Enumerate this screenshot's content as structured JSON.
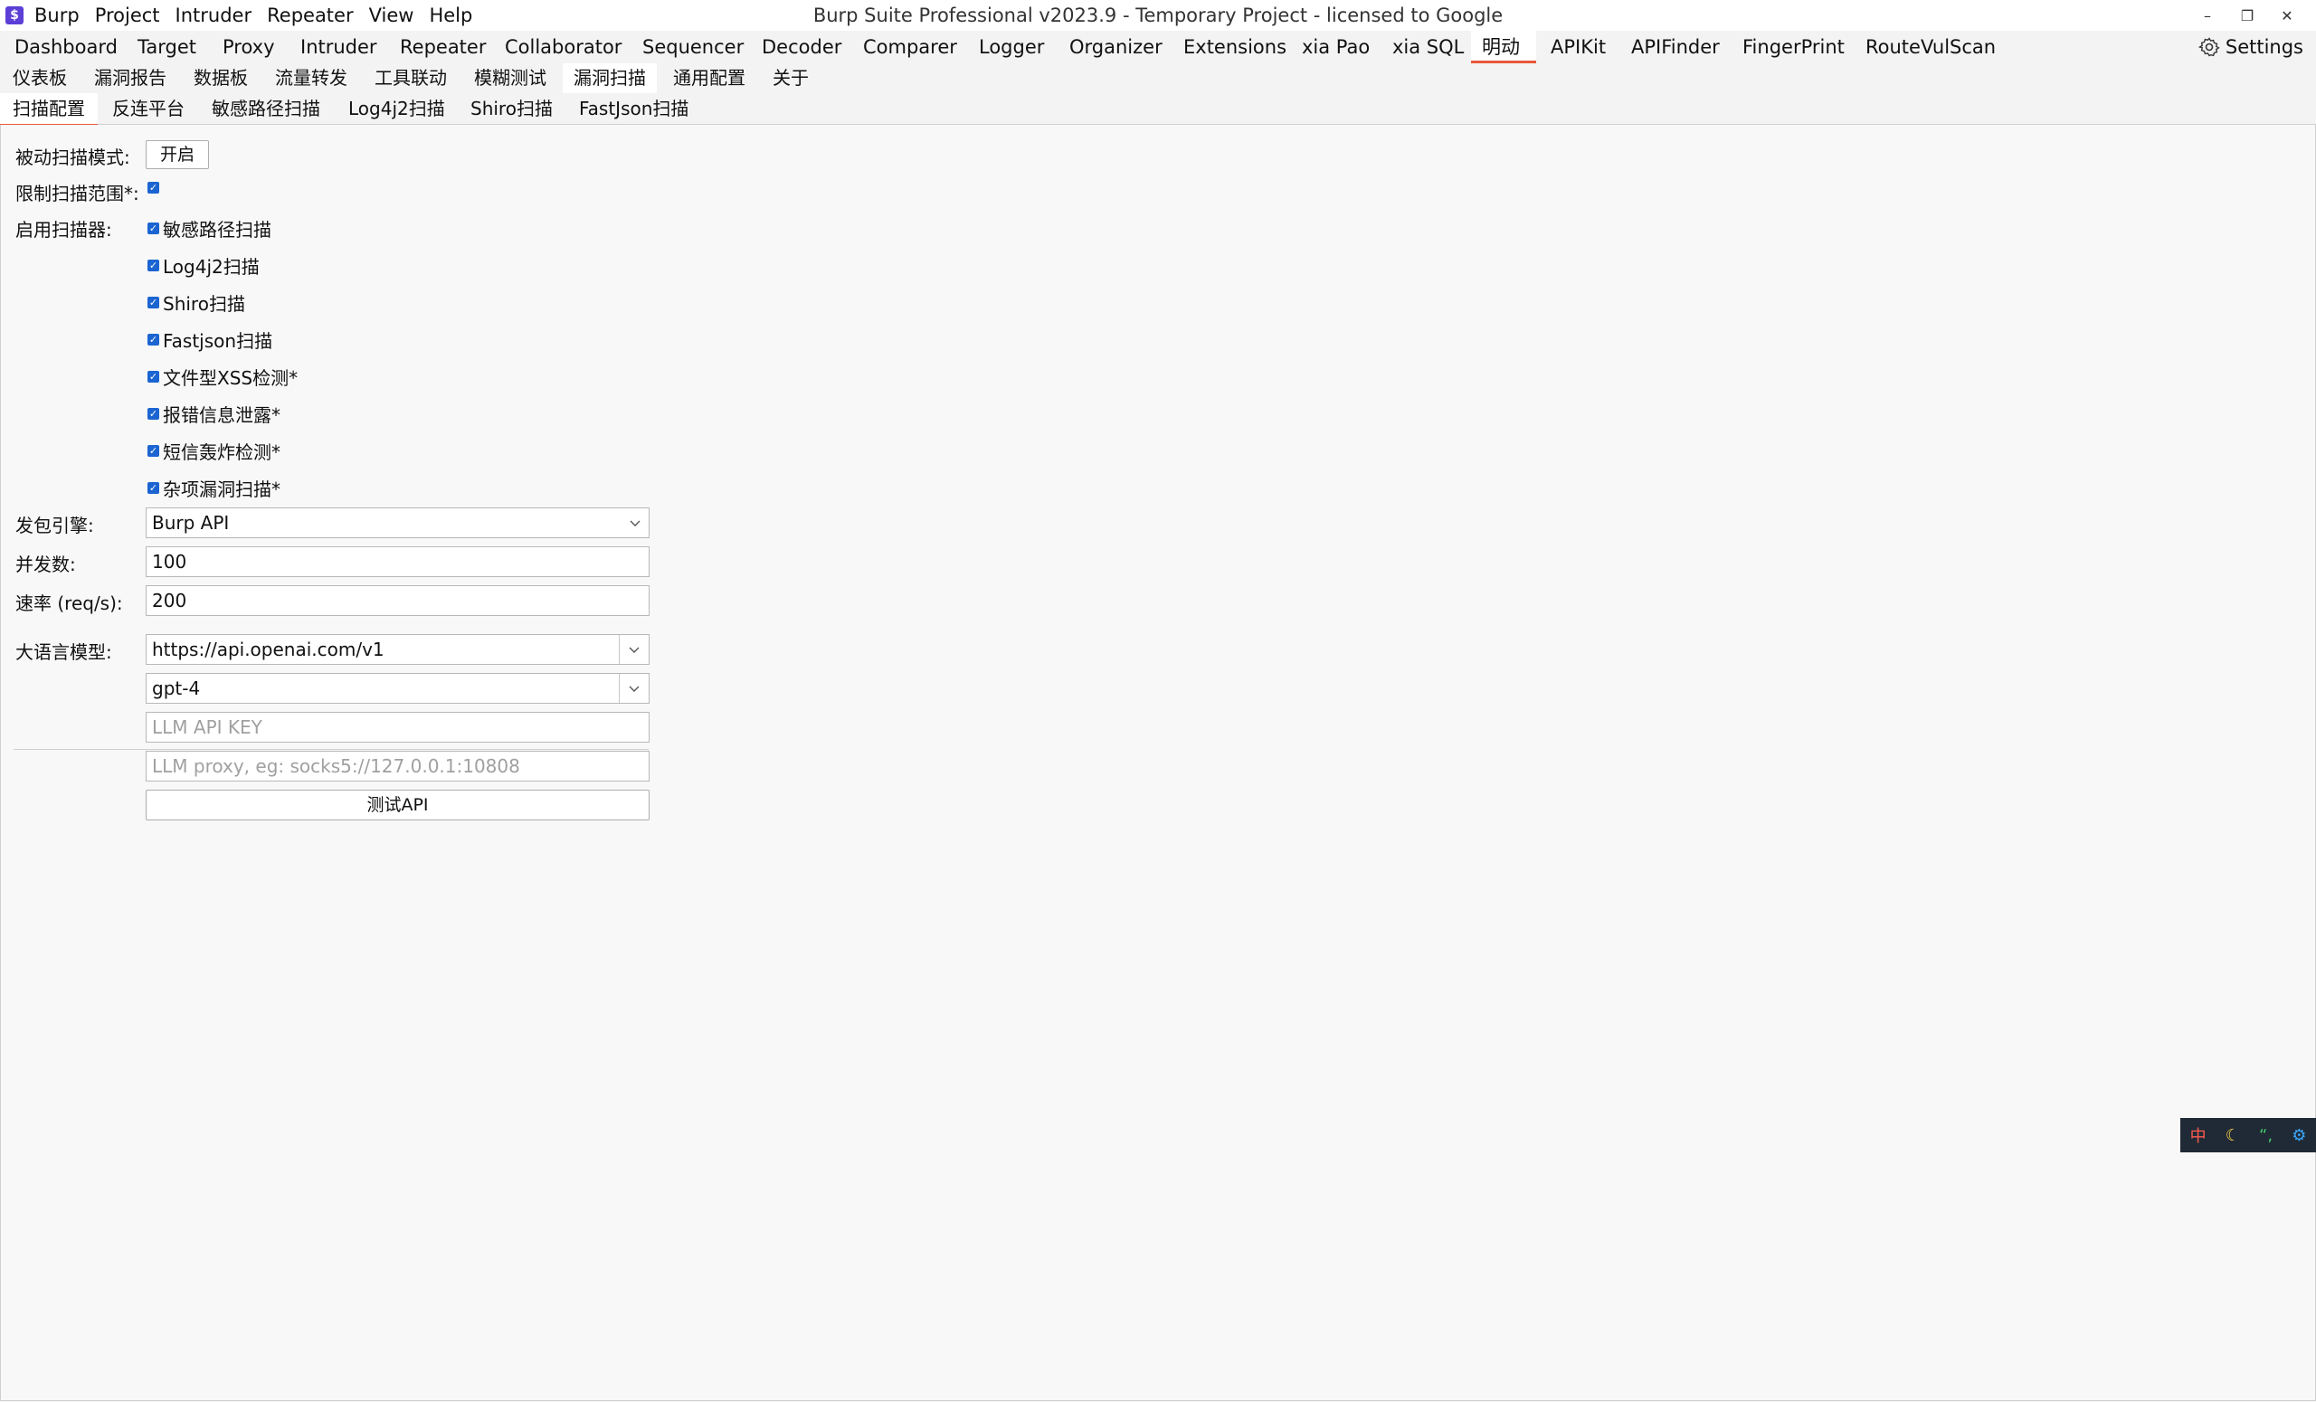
{
  "app": {
    "icon": "burp-logo-icon",
    "window_title": "Burp Suite Professional v2023.9 - Temporary Project - licensed to Google",
    "menu": [
      "Burp",
      "Project",
      "Intruder",
      "Repeater",
      "View",
      "Help"
    ],
    "window_controls": {
      "minimize": "–",
      "restore": "❐",
      "close": "✕"
    }
  },
  "main_tabs": [
    "Dashboard",
    "Target",
    "Proxy",
    "Intruder",
    "Repeater",
    "Collaborator",
    "Sequencer",
    "Decoder",
    "Comparer",
    "Logger",
    "Organizer",
    "Extensions",
    "xia Pao",
    "xia SQL",
    "明动",
    "APIKit",
    "APIFinder",
    "FingerPrint",
    "RouteVulScan"
  ],
  "main_tabs_active": "明动",
  "settings_label": "Settings",
  "plugin_tabs": [
    "仪表板",
    "漏洞报告",
    "数据板",
    "流量转发",
    "工具联动",
    "模糊测试",
    "漏洞扫描",
    "通用配置",
    "关于"
  ],
  "plugin_tabs_active": "漏洞扫描",
  "sub_tabs": [
    "扫描配置",
    "反连平台",
    "敏感路径扫描",
    "Log4j2扫描",
    "Shiro扫描",
    "FastJson扫描"
  ],
  "sub_tabs_active": "扫描配置",
  "form": {
    "passive_label": "被动扫描模式:",
    "passive_button": "开启",
    "limit_label": "限制扫描范围*:",
    "limit_checked": true,
    "scanners_label": "启用扫描器:",
    "scanners": [
      {
        "label": "敏感路径扫描",
        "checked": true
      },
      {
        "label": "Log4j2扫描",
        "checked": true
      },
      {
        "label": "Shiro扫描",
        "checked": true
      },
      {
        "label": "Fastjson扫描",
        "checked": true
      },
      {
        "label": "文件型XSS检测*",
        "checked": true
      },
      {
        "label": "报错信息泄露*",
        "checked": true
      },
      {
        "label": "短信轰炸检测*",
        "checked": true
      },
      {
        "label": "杂项漏洞扫描*",
        "checked": true
      }
    ],
    "engine_label": "发包引擎:",
    "engine_value": "Burp API",
    "concurrency_label": "并发数:",
    "concurrency_value": "100",
    "rate_label": "速率 (req/s):",
    "rate_value": "200",
    "llm_label": "大语言模型:",
    "llm_url": "https://api.openai.com/v1",
    "llm_model": "gpt-4",
    "llm_key_placeholder": "LLM API KEY",
    "llm_proxy_placeholder": "LLM proxy, eg: socks5://127.0.0.1:10808",
    "test_button": "测试API"
  },
  "ime": {
    "items": [
      "中",
      "☾",
      "“,",
      "⚙"
    ]
  },
  "colors": {
    "accent": "#e8583a",
    "checkbox": "#1b64d1",
    "ime_bg": "#1f2a36"
  }
}
